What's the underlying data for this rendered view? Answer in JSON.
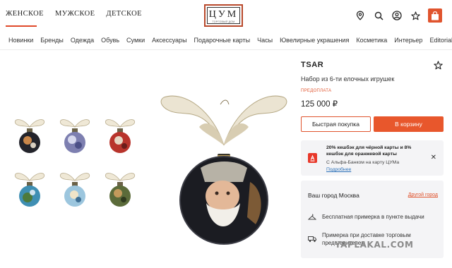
{
  "header": {
    "gender_tabs": [
      "ЖЕНСКОЕ",
      "МУЖСКОЕ",
      "ДЕТСКОЕ"
    ],
    "logo_text": "ЦУМ",
    "logo_subtext": "ТОРГОВЫЙ ДОМ",
    "icons": [
      "location-icon",
      "search-icon",
      "user-icon",
      "star-icon",
      "bag-icon"
    ],
    "accent_color": "#e0542e"
  },
  "categories": [
    "Новинки",
    "Бренды",
    "Одежда",
    "Обувь",
    "Сумки",
    "Аксессуары",
    "Подарочные карты",
    "Часы",
    "Ювелирные украшения",
    "Косметика",
    "Интерьер",
    "Editorial"
  ],
  "product": {
    "brand": "TSAR",
    "name": "Набор из 6-ти елочных игрушек",
    "prepay_label": "ПРЕДОПЛАТА",
    "price": "125 000 ₽",
    "quick_buy_label": "Быстрая покупка",
    "cart_label": "В корзину"
  },
  "promo": {
    "title": "20% кешбэк для чёрной карты и 8% кешбэк для оранжевой карты",
    "subtitle": "С Альфа-Банком на карту ЦУМа",
    "link": "Подробнее",
    "bank_logo": "А"
  },
  "city": {
    "title": "Ваш город Москва",
    "change_link": "Другой город",
    "rows": [
      "Бесплатная примерка в пункте выдачи",
      "Примерка при доставке торговым представителем"
    ]
  },
  "watermark": "YAPLAKAL.COM"
}
